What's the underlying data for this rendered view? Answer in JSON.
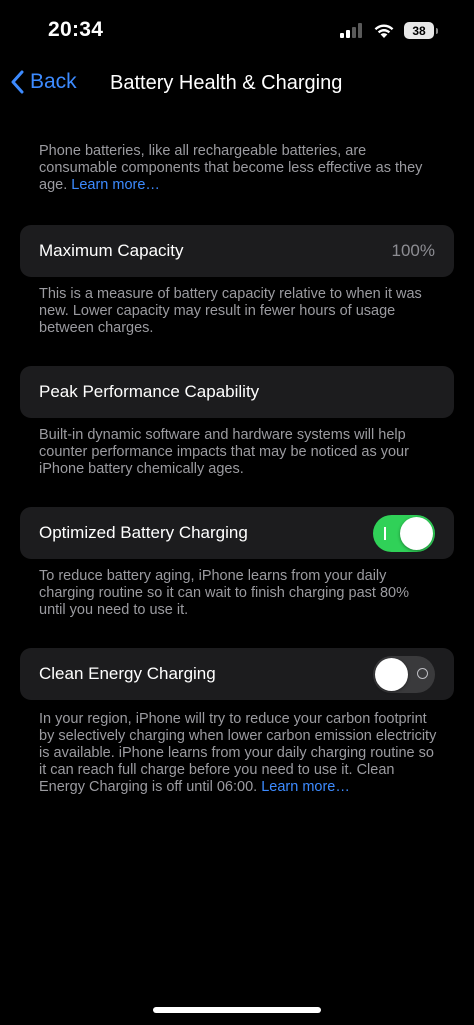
{
  "status_bar": {
    "time": "20:34",
    "battery_level": "38"
  },
  "nav": {
    "back_label": "Back",
    "title": "Battery Health & Charging"
  },
  "intro": {
    "text": "Phone batteries, like all rechargeable batteries, are consumable components that become less effective as they age.",
    "link": "Learn more…"
  },
  "max_capacity": {
    "label": "Maximum Capacity",
    "value": "100%",
    "description": "This is a measure of battery capacity relative to when it was new. Lower capacity may result in fewer hours of usage between charges."
  },
  "peak_performance": {
    "label": "Peak Performance Capability",
    "description": "Built-in dynamic software and hardware systems will help counter performance impacts that may be noticed as your iPhone battery chemically ages."
  },
  "optimized_charging": {
    "label": "Optimized Battery Charging",
    "enabled": true,
    "description": "To reduce battery aging, iPhone learns from your daily charging routine so it can wait to finish charging past 80% until you need to use it."
  },
  "clean_energy": {
    "label": "Clean Energy Charging",
    "enabled": false,
    "description": "In your region, iPhone will try to reduce your carbon footprint by selectively charging when lower carbon emission electricity is available. iPhone learns from your daily charging routine so it can reach full charge before you need to use it. Clean Energy Charging is off until 06:00.",
    "link": "Learn more…"
  },
  "colors": {
    "accent": "#3d8bff",
    "toggle_on": "#30d158",
    "cell_bg": "#1c1c1e",
    "secondary_text": "#9b9ba0"
  }
}
